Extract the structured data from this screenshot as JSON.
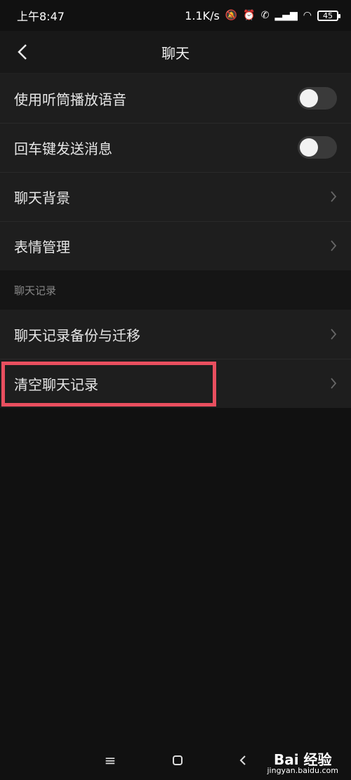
{
  "status_bar": {
    "time": "上午8:47",
    "net_speed": "1.1K/s",
    "battery": "45"
  },
  "header": {
    "title": "聊天"
  },
  "settings": {
    "items": [
      {
        "label": "使用听筒播放语音",
        "type": "toggle",
        "on": false
      },
      {
        "label": "回车键发送消息",
        "type": "toggle",
        "on": false
      },
      {
        "label": "聊天背景",
        "type": "link"
      },
      {
        "label": "表情管理",
        "type": "link"
      }
    ]
  },
  "chat_records": {
    "header": "聊天记录",
    "items": [
      {
        "label": "聊天记录备份与迁移",
        "type": "link"
      },
      {
        "label": "清空聊天记录",
        "type": "link",
        "highlighted": true
      }
    ]
  },
  "navbar": {
    "menu_icon": "≡",
    "home_icon": "▢",
    "back_icon": "‹"
  },
  "watermark": {
    "logo": "Bai 经验",
    "url": "jingyan.baidu.com"
  },
  "colors": {
    "highlight": "#e94f5f",
    "background": "#111111",
    "row_background": "#1e1e1e"
  }
}
